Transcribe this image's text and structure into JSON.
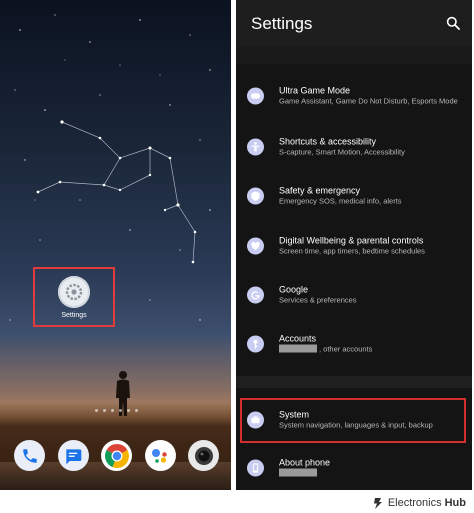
{
  "home": {
    "settings_app_label": "Settings",
    "dock_apps": [
      {
        "name": "phone",
        "icon": "phone-icon",
        "color": "#e9eef8"
      },
      {
        "name": "messages",
        "icon": "messages-icon",
        "color": "#e9eef8"
      },
      {
        "name": "chrome",
        "icon": "chrome-icon",
        "color": "#ffffff"
      },
      {
        "name": "assistant",
        "icon": "assistant-icon",
        "color": "#ffffff"
      },
      {
        "name": "camera",
        "icon": "camera-icon",
        "color": "#e9e9e9"
      }
    ],
    "highlight_color": "#e23b3b"
  },
  "settings": {
    "title": "Settings",
    "items": [
      {
        "title": "Ultra Game Mode",
        "subtitle": "Game Assistant, Game Do Not Disturb, Esports Mode",
        "icon": "gamepad-icon"
      },
      {
        "title": "Shortcuts & accessibility",
        "subtitle": "S-capture, Smart Motion, Accessibility",
        "icon": "accessibility-icon"
      },
      {
        "title": "Safety & emergency",
        "subtitle": "Emergency SOS, medical info, alerts",
        "icon": "shield-icon"
      },
      {
        "title": "Digital Wellbeing & parental controls",
        "subtitle": "Screen time, app timers, bedtime schedules",
        "icon": "wellbeing-icon"
      },
      {
        "title": "Google",
        "subtitle": "Services & preferences",
        "icon": "google-icon"
      },
      {
        "title": "Accounts",
        "subtitle": ", other accounts",
        "icon": "key-icon"
      },
      {
        "title": "System",
        "subtitle": "System navigation, languages & input, backup",
        "icon": "info-icon"
      },
      {
        "title": "About phone",
        "subtitle": "",
        "icon": "phone-info-icon"
      }
    ],
    "accent": "#c9cdf2",
    "highlight_color": "#d32f2f"
  },
  "watermark": {
    "brand_light": "Electronics",
    "brand_bold": "Hub"
  }
}
